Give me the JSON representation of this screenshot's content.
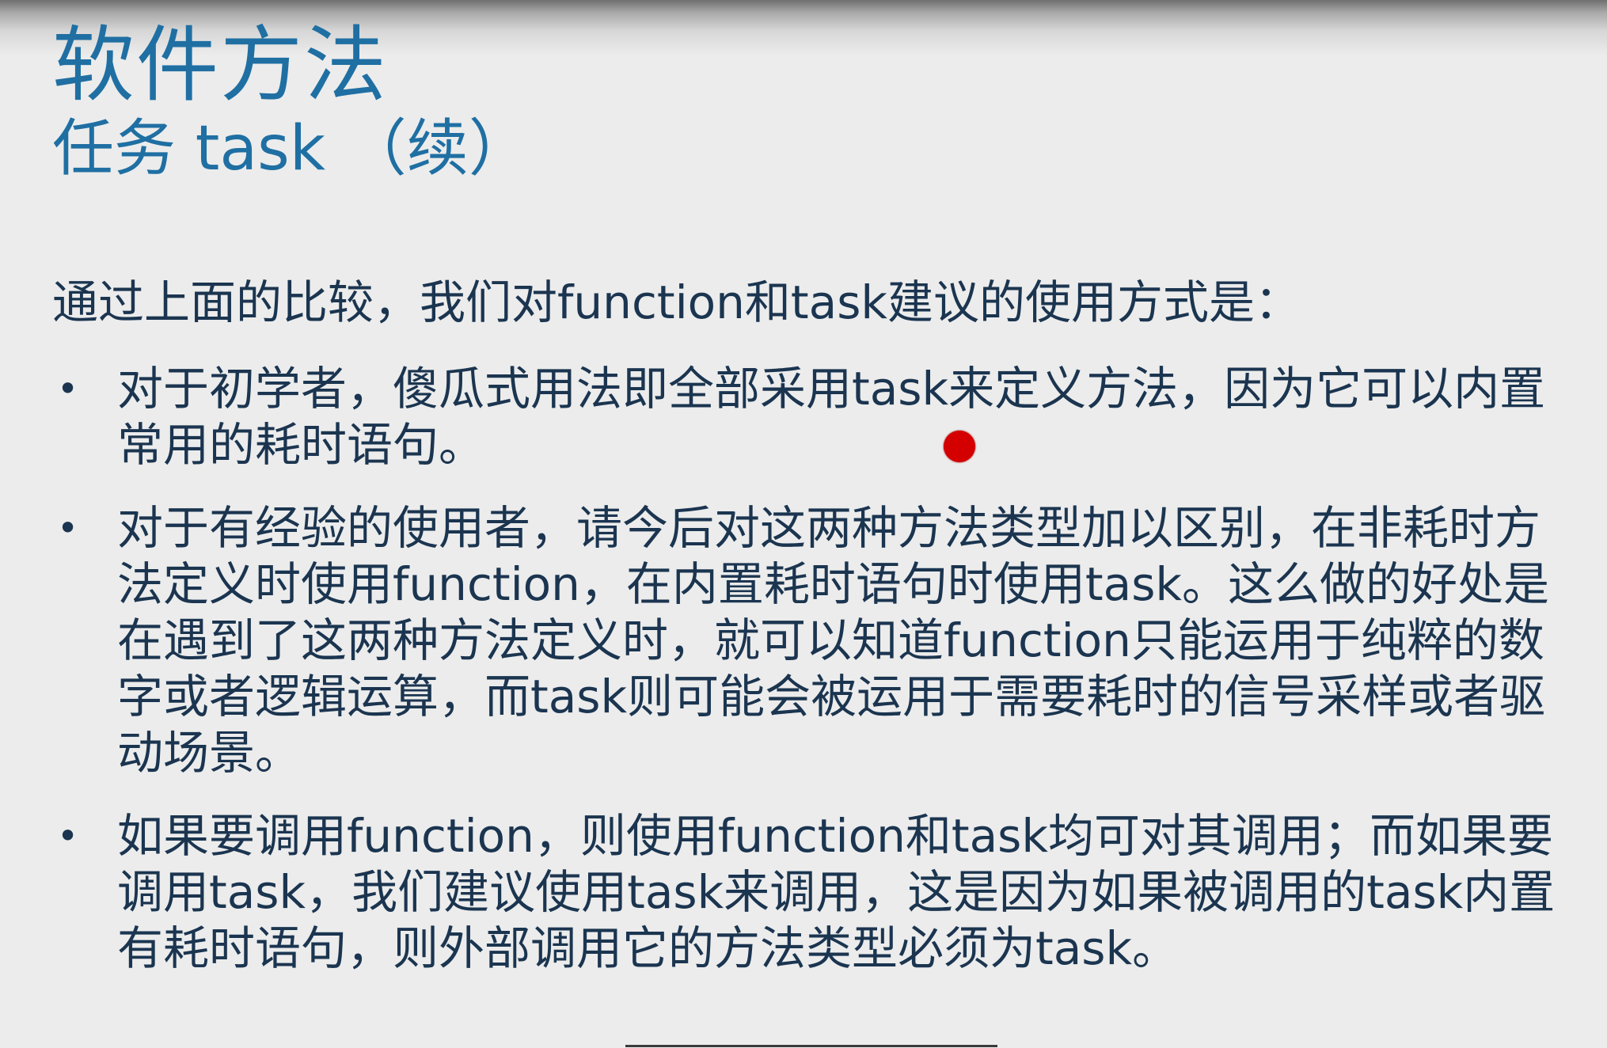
{
  "slide": {
    "title": "软件方法",
    "subtitle": "任务 task （续）",
    "intro": "通过上面的比较，我们对function和task建议的使用方式是：",
    "bullet_symbol": "•",
    "bullets": [
      {
        "text": "对于初学者，傻瓜式用法即全部采用task来定义方法，因为它可以内置常用的耗时语句。"
      },
      {
        "text": "对于有经验的使用者，请今后对这两种方法类型加以区别，在非耗时方法定义时使用function，在内置耗时语句时使用task。这么做的好处是在遇到了这两种方法定义时，就可以知道function只能运用于纯粹的数字或者逻辑运算，而task则可能会被运用于需要耗时的信号采样或者驱动场景。"
      },
      {
        "text": "如果要调用function，则使用function和task均可对其调用；而如果要调用task，我们建议使用task来调用，这是因为如果被调用的task内置有耗时语句，则外部调用它的方法类型必须为task。"
      }
    ]
  },
  "colors": {
    "title": "#1f6fa3",
    "body_text": "#1b3550",
    "background": "#ececec",
    "pointer": "#d40000"
  },
  "icons": {
    "pointer": "red-laser-pointer-dot"
  }
}
